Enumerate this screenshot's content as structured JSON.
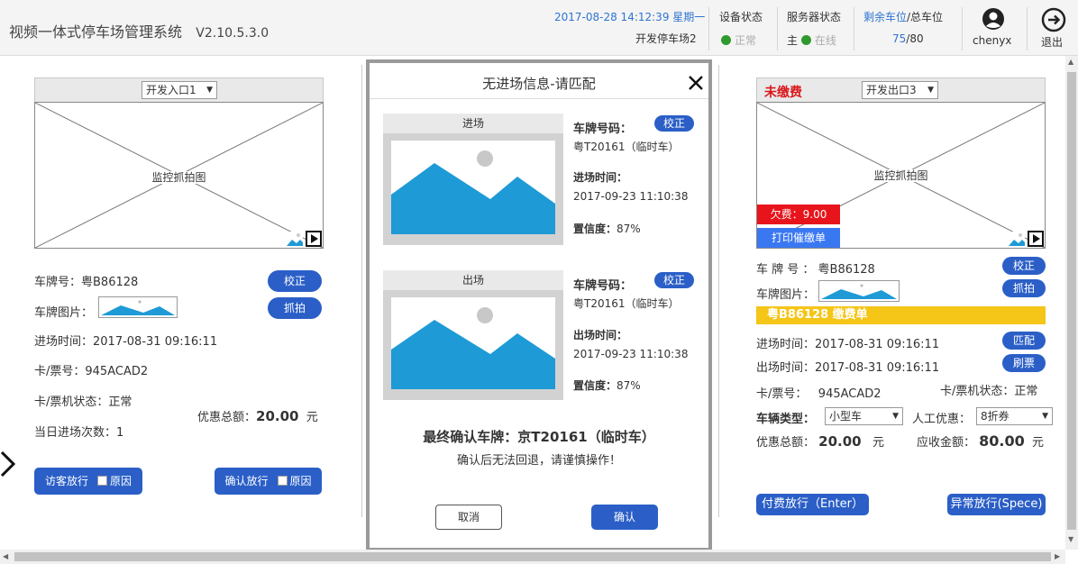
{
  "header": {
    "app_title": "视频一体式停车场管理系统",
    "version": "V2.10.5.3.0",
    "datetime": "2017-08-28 14:12:39 星期一",
    "site": "开发停车场2",
    "device_status_label": "设备状态",
    "device_status_value": "正常",
    "server_status_label": "服务器状态",
    "server_role": "主",
    "server_status_value": "在线",
    "spaces_label_a": "剩余车位",
    "spaces_label_b": "/总车位",
    "spaces_remaining": "75",
    "spaces_total": "/80",
    "user": "chenyx",
    "logout": "退出"
  },
  "left": {
    "entrance_select": "开发入口1",
    "cam_label": "监控抓拍图",
    "plate_label": "车牌号：",
    "plate_value": "粤B86128",
    "plate_img_label": "车牌图片：",
    "correct_btn": "校正",
    "capture_btn": "抓拍",
    "entry_time_label": "进场时间：",
    "entry_time_value": "2017-08-31 09:16:11",
    "card_label": "卡/票号：",
    "card_value": "945ACAD2",
    "card_status_label": "卡/票机状态：",
    "card_status_value": "正常",
    "visits_label": "当日进场次数：",
    "visits_value": "1",
    "discount_label": "优惠总额：",
    "discount_value": "20.00",
    "discount_unit": "元",
    "visitor_btn": "访客放行",
    "visitor_reason": "原因",
    "confirm_btn": "确认放行",
    "confirm_reason": "原因"
  },
  "modal": {
    "title": "无进场信息-请匹配",
    "entry_header": "进场",
    "exit_header": "出场",
    "plate_label": "车牌号码：",
    "correct_btn": "校正",
    "entry_plate": "粤T20161（临时车）",
    "entry_time_label": "进场时间：",
    "entry_time_value": "2017-09-23  11:10:38",
    "confidence_label": "置信度：",
    "entry_conf": "87%",
    "exit_plate": "粤T20161（临时车）",
    "exit_time_label": "出场时间：",
    "exit_time_value": "2017-09-23  11:10:38",
    "exit_conf": "87%",
    "final_label": "最终确认车牌：京T20161（临时车）",
    "warn": "确认后无法回退，请谨慎操作！",
    "cancel_btn": "取消",
    "confirm_btn": "确认"
  },
  "right": {
    "unpaid": "未缴费",
    "exit_select": "开发出口3",
    "cam_label": "监控抓拍图",
    "owed": "欠费：9.00",
    "print_btn": "打印催缴单",
    "plate_label": "车 牌 号 ：",
    "plate_value": "粤B86128",
    "plate_img_label": "车牌图片：",
    "correct_btn": "校正",
    "capture_btn": "抓拍",
    "bill_banner": "粤B86128  缴费单",
    "entry_time_label": "进场时间：",
    "entry_time_value": "2017-08-31 09:16:11",
    "match_btn": "匹配",
    "exit_time_label": "出场时间：",
    "exit_time_value": "2017-08-31 09:16:11",
    "swipe_btn": "刷票",
    "card_label": "卡/票号：",
    "card_value": "945ACAD2",
    "card_status_label": "卡/票机状态：",
    "card_status_value": "正常",
    "vehicle_type_label": "车辆类型：",
    "vehicle_type_value": "小型车",
    "manual_discount_label": "人工优惠：",
    "manual_discount_value": "8折券",
    "discount_label": "优惠总额：",
    "discount_value": "20.00",
    "discount_unit": "元",
    "receivable_label": "应收金额：",
    "receivable_value": "80.00",
    "receivable_unit": "元",
    "pay_btn": "付费放行（Enter）",
    "abnormal_btn": "异常放行(Spece)"
  },
  "colors": {
    "primary_blue": "#2b5fc7",
    "landscape_blue": "#1e9ad6",
    "unpaid_red": "#d9161b",
    "owed_bg": "#e8141b",
    "print_bg": "#3a78f2",
    "banner_yellow": "#f5c518",
    "status_green": "#2e9a2e"
  }
}
